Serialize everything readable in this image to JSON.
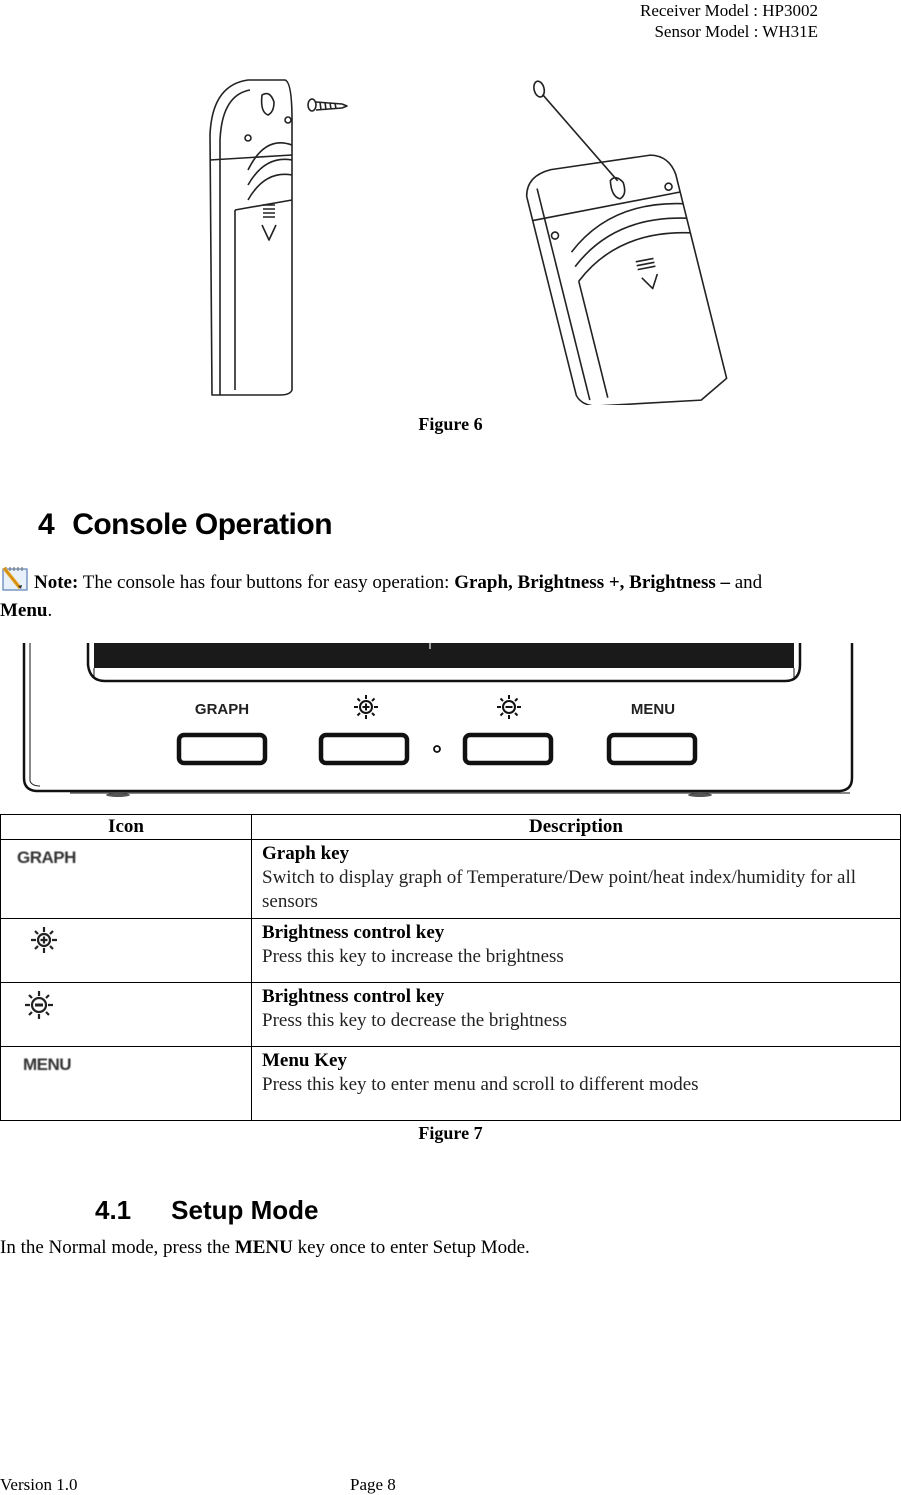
{
  "header": {
    "receiver_model": "Receiver Model : HP3002",
    "sensor_model": "Sensor Model : WH31E"
  },
  "figure6": {
    "caption": "Figure 6",
    "description": "Two sensor units: wall-mounting with screw (left) and hanging by string loop (right)"
  },
  "section4": {
    "number": "4",
    "title": "Console Operation"
  },
  "note": {
    "icon": "notepad-pencil-icon",
    "label": "Note:",
    "text_before": " The console has four buttons for easy operation: ",
    "bold_buttons": "Graph, Brightness +, Brightness –",
    "text_and": " and ",
    "bold_last": "Menu",
    "text_end": "."
  },
  "console_figure": {
    "buttons": [
      {
        "label": "GRAPH",
        "icon": "text"
      },
      {
        "label": "",
        "icon": "sun-plus-icon"
      },
      {
        "label": "",
        "icon": "sun-minus-icon"
      },
      {
        "label": "MENU",
        "icon": "text"
      }
    ]
  },
  "keys_table": {
    "headers": [
      "Icon",
      "Description"
    ],
    "rows": [
      {
        "icon_label": "GRAPH",
        "icon": "graph-text-icon",
        "title": "Graph key",
        "description": "Switch to display graph of Temperature/Dew point/heat index/humidity for all sensors"
      },
      {
        "icon_label": "",
        "icon": "brightness-plus-icon",
        "title": "Brightness control key",
        "description": "Press this key to increase the brightness"
      },
      {
        "icon_label": "",
        "icon": "brightness-minus-icon",
        "title": "Brightness control key",
        "description": "Press this key to decrease the brightness"
      },
      {
        "icon_label": "MENU",
        "icon": "menu-text-icon",
        "title": "Menu Key",
        "description": "Press this key to enter menu and scroll to different modes"
      }
    ]
  },
  "figure7": {
    "caption": "Figure 7"
  },
  "section4_1": {
    "number": "4.1",
    "title": "Setup Mode"
  },
  "setup_paragraph": {
    "before": "In the Normal mode, press the ",
    "bold": "MENU",
    "after": " key once to enter Setup Mode."
  },
  "footer": {
    "version": "Version 1.0",
    "page": "Page 8"
  }
}
